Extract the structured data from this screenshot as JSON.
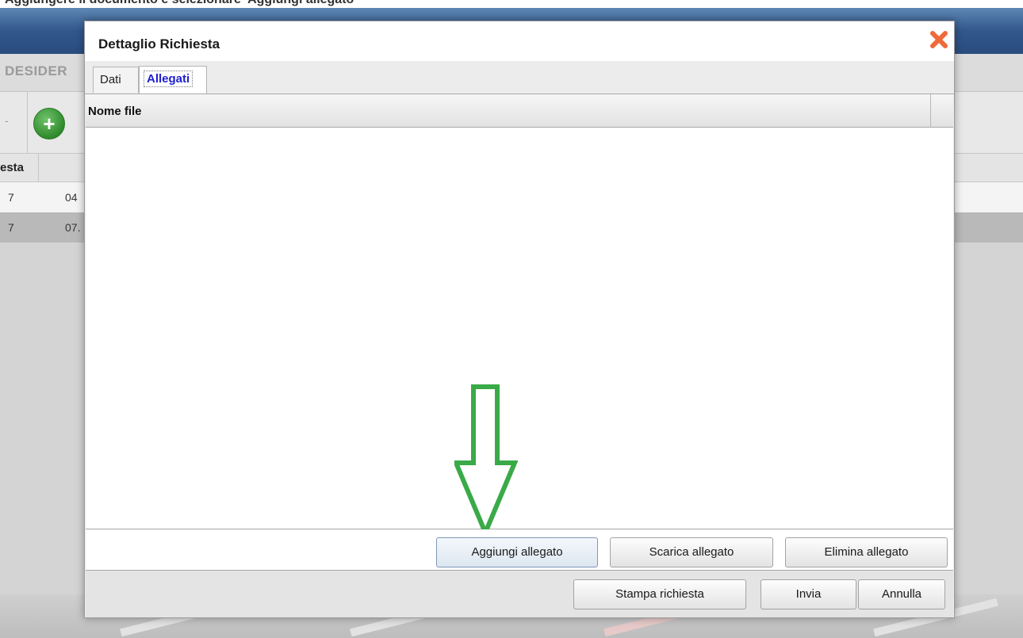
{
  "caption": "Aggiungere il documento e selezionare 'Aggiungi allegato'",
  "background": {
    "page_title": "DESIDER",
    "table_header": "esta",
    "rows": [
      {
        "col_a": "7",
        "col_b": "04"
      },
      {
        "col_a": "7",
        "col_b": "07."
      }
    ],
    "add_icon": "plus-circle-icon"
  },
  "dialog": {
    "title": "Dettaglio Richiesta",
    "close_icon": "close-x-icon",
    "tabs": [
      {
        "label": "Dati",
        "active": false
      },
      {
        "label": "Allegati",
        "active": true
      }
    ],
    "file_table": {
      "column_header": "Nome file",
      "rows": []
    },
    "attachment_buttons": {
      "add": "Aggiungi allegato",
      "download": "Scarica allegato",
      "delete": "Elimina allegato"
    },
    "footer_buttons": {
      "print": "Stampa richiesta",
      "send": "Invia",
      "cancel": "Annulla"
    }
  },
  "annotation": {
    "type": "arrow-down",
    "color": "#3aaa48",
    "points_to": "Aggiungi allegato"
  }
}
